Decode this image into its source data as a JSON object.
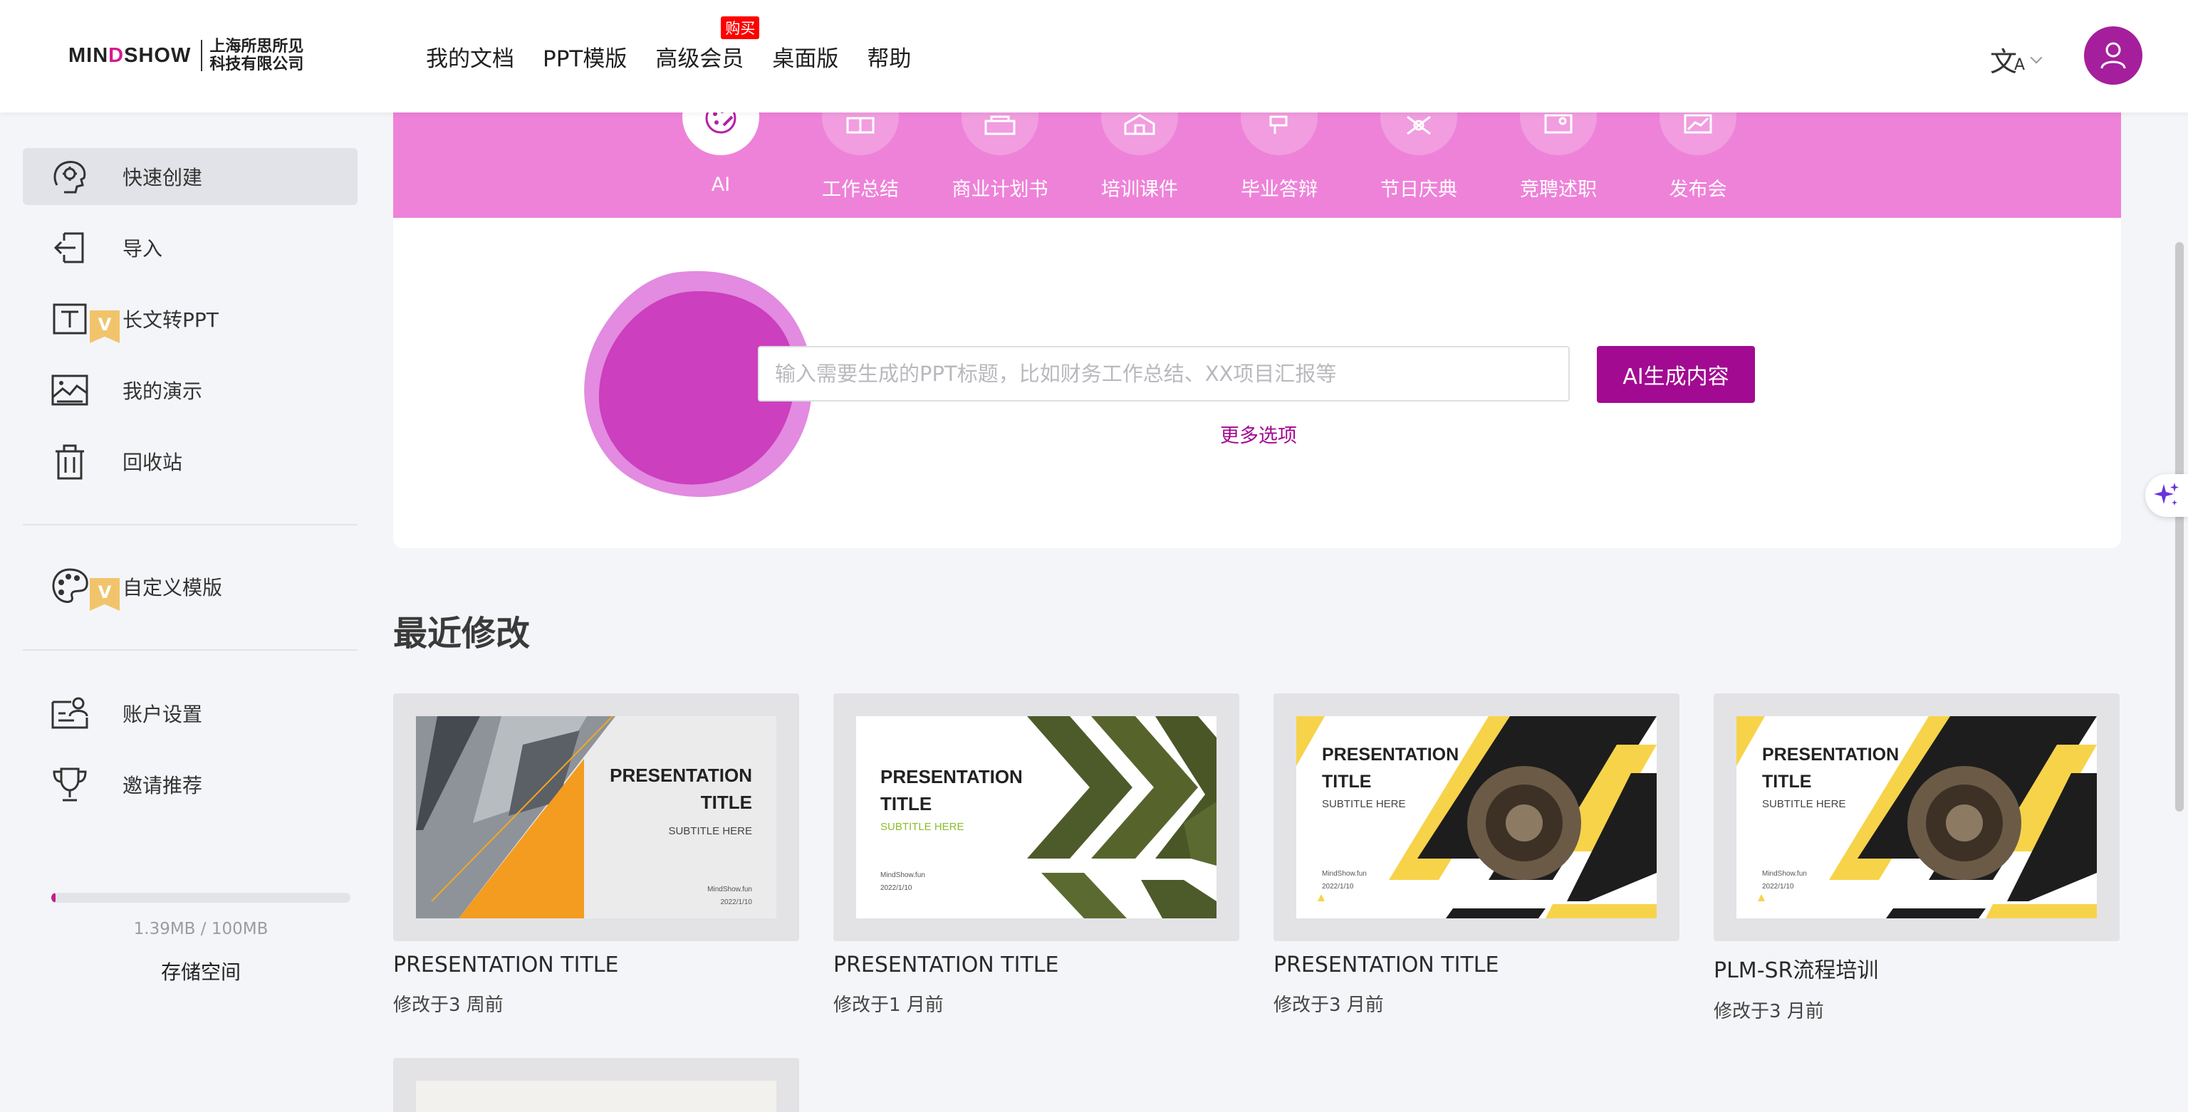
{
  "header": {
    "logo_text_a": "MIN",
    "logo_text_o": "D",
    "logo_text_b": "SHOW",
    "logo_cn_line1": "上海所思所见",
    "logo_cn_line2": "科技有限公司",
    "nav": [
      "我的文档",
      "PPT模版",
      "高级会员",
      "桌面版",
      "帮助"
    ],
    "nav_badge": "购买",
    "lang_glyph": "文",
    "lang_sub": "A"
  },
  "sidebar": {
    "items": [
      {
        "label": "快速创建",
        "icon": "brain-head-icon",
        "active": true
      },
      {
        "label": "导入",
        "icon": "import-icon"
      },
      {
        "label": "长文转PPT",
        "icon": "text-to-ppt-icon",
        "vip": true
      },
      {
        "label": "我的演示",
        "icon": "presentation-image-icon"
      },
      {
        "label": "回收站",
        "icon": "trash-icon"
      },
      {
        "label": "自定义模版",
        "icon": "palette-icon",
        "vip": true
      },
      {
        "label": "账户设置",
        "icon": "account-card-icon"
      },
      {
        "label": "邀请推荐",
        "icon": "trophy-icon"
      }
    ],
    "vip_tag": "V",
    "storage": {
      "title": "存储空间",
      "used_text": "1.39MB / 100MB",
      "used_fraction": 0.0139
    }
  },
  "banner": {
    "categories": [
      "AI",
      "工作总结",
      "商业计划书",
      "培训课件",
      "毕业答辩",
      "节日庆典",
      "竞聘述职",
      "发布会"
    ]
  },
  "ai_panel": {
    "placeholder": "输入需要生成的PPT标题，比如财务工作总结、XX项目汇报等",
    "button": "AI生成内容",
    "more_options": "更多选项"
  },
  "recent": {
    "title": "最近修改",
    "cards": [
      {
        "title": "PRESENTATION TITLE",
        "modified": "修改于3 周前",
        "slide": {
          "t1": "PRESENTATION",
          "t2": "TITLE",
          "sub": "SUBTITLE HERE",
          "site": "MindShow.fun",
          "date": "2022/1/10"
        }
      },
      {
        "title": "PRESENTATION TITLE",
        "modified": "修改于1 月前",
        "slide": {
          "t1": "PRESENTATION",
          "t2": "TITLE",
          "sub": "SUBTITLE HERE",
          "site": "MindShow.fun",
          "date": "2022/1/10"
        }
      },
      {
        "title": "PRESENTATION TITLE",
        "modified": "修改于3 月前",
        "slide": {
          "t1": "PRESENTATION",
          "t2": "TITLE",
          "sub": "SUBTITLE HERE",
          "site": "MindShow.fun",
          "date": "2022/1/10"
        }
      },
      {
        "title": "PLM-SR流程培训",
        "modified": "修改于3 月前",
        "slide": {
          "t1": "PRESENTATION",
          "t2": "TITLE",
          "sub": "SUBTITLE HERE",
          "site": "MindShow.fun",
          "date": "2022/1/10"
        }
      }
    ]
  },
  "colors": {
    "brand": "#a20a91",
    "banner": "#ee82d8",
    "badge": "#ff0000",
    "avatar": "#a51f9c"
  }
}
